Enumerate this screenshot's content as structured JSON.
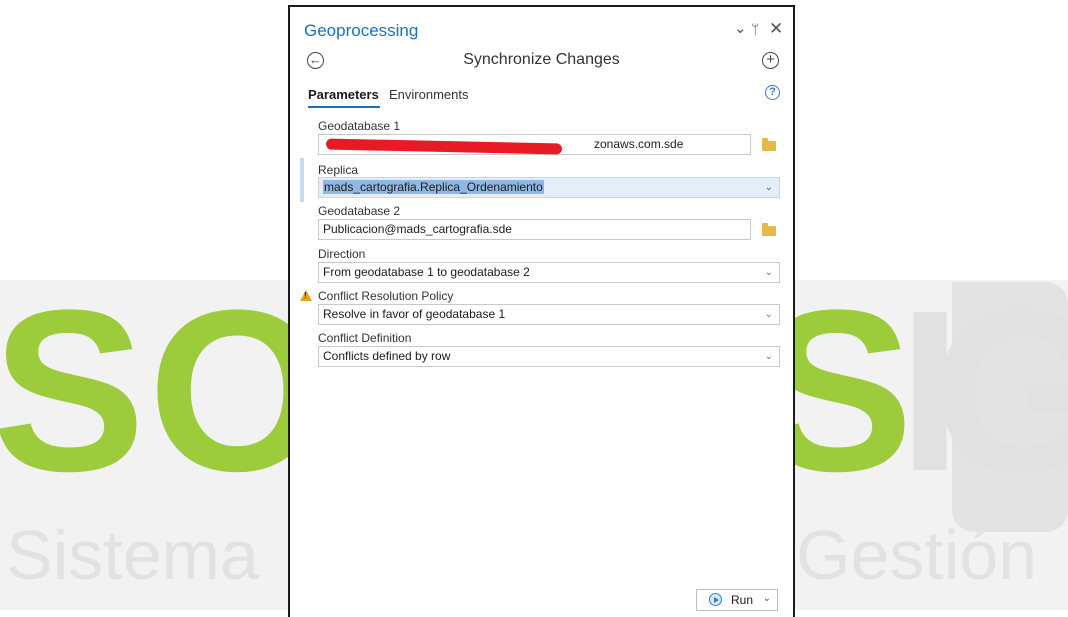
{
  "background": {
    "logo_letters": [
      "S",
      "O",
      "S",
      "I",
      "G"
    ],
    "words": [
      "Sistema",
      "Gestión"
    ],
    "colors": {
      "green": "#9ccb3b",
      "gray": "#e1e1e1"
    }
  },
  "pane": {
    "title": "Geoprocessing",
    "controls": {
      "collapse": "⌄",
      "pin": "ᛘ",
      "close": "✕"
    },
    "tool_title": "Synchronize Changes",
    "back_icon": "arrow-left-circle-icon",
    "add_icon": "plus-circle-icon",
    "tabs": [
      {
        "label": "Parameters",
        "active": true
      },
      {
        "label": "Environments",
        "active": false
      }
    ],
    "help_glyph": "?",
    "parameters": {
      "geodatabase1": {
        "label": "Geodatabase 1",
        "value": "mads_pdb.rds.cly4coq9yo4z.us-east-1.rds.amazonaws.com.sde",
        "visible_suffix": "zonaws.com.sde",
        "redacted": true
      },
      "replica": {
        "label": "Replica",
        "value": "mads_cartografia.Replica_Ordenamiento",
        "selected": true
      },
      "geodatabase2": {
        "label": "Geodatabase 2",
        "value": "Publicacion@mads_cartografia.sde"
      },
      "direction": {
        "label": "Direction",
        "value": "From geodatabase 1 to geodatabase 2"
      },
      "conflict_policy": {
        "label": "Conflict Resolution Policy",
        "value": "Resolve in favor of geodatabase 1",
        "warning": true
      },
      "conflict_definition": {
        "label": "Conflict Definition",
        "value": "Conflicts defined by row"
      }
    },
    "run_button": {
      "label": "Run"
    },
    "colors": {
      "accent": "#1f6fb8",
      "redaction": "#e81b24",
      "warning": "#e7a21f",
      "selection": "#8fb8e6"
    }
  }
}
